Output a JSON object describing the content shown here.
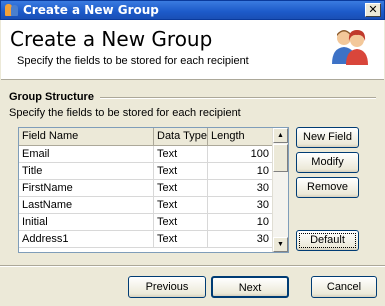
{
  "window": {
    "title": "Create a New Group",
    "close_glyph": "✕"
  },
  "header": {
    "title": "Create a New Group",
    "subtitle": "Specify the fields to be stored for each recipient",
    "icon": "people-icon"
  },
  "section": {
    "label": "Group Structure",
    "description": "Specify the fields to be stored for each recipient"
  },
  "table": {
    "columns": [
      "Field Name",
      "Data Type",
      "Length"
    ],
    "rows": [
      [
        "Email",
        "Text",
        "100"
      ],
      [
        "Title",
        "Text",
        "10"
      ],
      [
        "FirstName",
        "Text",
        "30"
      ],
      [
        "LastName",
        "Text",
        "30"
      ],
      [
        "Initial",
        "Text",
        "10"
      ],
      [
        "Address1",
        "Text",
        "30"
      ]
    ],
    "scroll_up_glyph": "▲",
    "scroll_down_glyph": "▼"
  },
  "side_buttons": {
    "new_field": "New Field",
    "modify": "Modify",
    "remove": "Remove",
    "default": "Default"
  },
  "footer": {
    "previous": "Previous",
    "next": "Next",
    "cancel": "Cancel"
  }
}
